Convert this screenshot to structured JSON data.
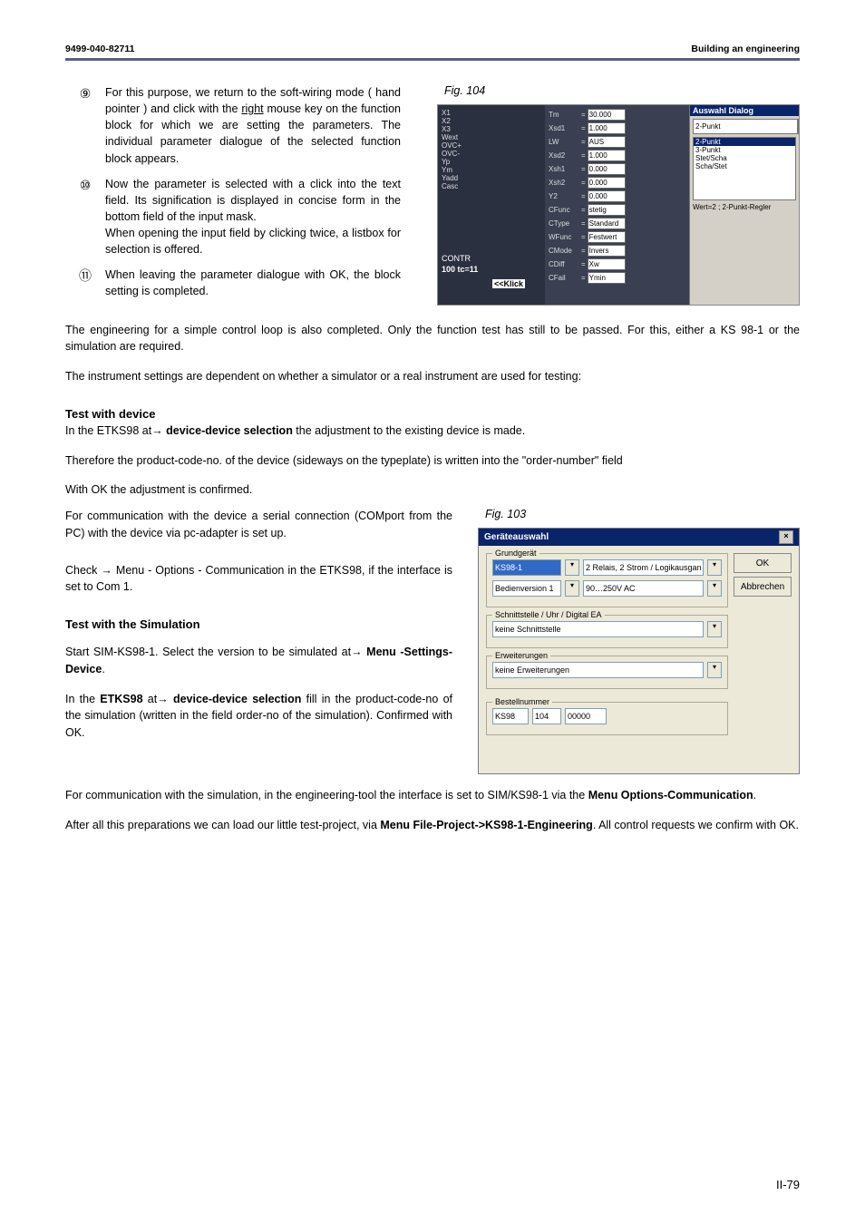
{
  "header": {
    "left": "9499-040-82711",
    "right": "Building an engineering"
  },
  "steps": [
    {
      "num": "⑨",
      "pre": "For this purpose, we return to the soft-wiring mode ( hand pointer ) and click with the ",
      "under": "right",
      "post": " mouse key on the function block for which we are setting the parameters.  The individual parameter dialogue of the selected function block appears."
    },
    {
      "num": "⑩",
      "text": "Now the parameter is selected with a click into the text field. Its signification is displayed in concise form in the bottom field of the input mask.\nWhen opening the input field by clicking twice, a listbox for selection is offered."
    },
    {
      "num": "⑪",
      "text": "When leaving the parameter dialogue with OK, the block setting is completed."
    }
  ],
  "fig104": {
    "caption": "Fig. 104",
    "rows": [
      [
        "Tm",
        "30.000"
      ],
      [
        "Xsd1",
        "1.000"
      ],
      [
        "LW",
        "AUS"
      ],
      [
        "Xsd2",
        "1.000"
      ],
      [
        "Xsh1",
        "0.000"
      ],
      [
        "Xsh2",
        "0.000"
      ],
      [
        "Y2",
        "0.000"
      ]
    ],
    "rows2": [
      [
        "CFunc",
        "stetig"
      ],
      [
        "CType",
        "Standard"
      ],
      [
        "WFunc",
        "Festwert"
      ],
      [
        "CMode",
        "Invers"
      ],
      [
        "CDiff",
        "Xw"
      ],
      [
        "CFail",
        "Ymin"
      ]
    ],
    "left_labels": [
      "X1",
      "X2",
      "X3",
      "Wext",
      "OVC+",
      "OVC-",
      "Yp",
      "Ym",
      "Yadd",
      "Casc"
    ],
    "bottom_left": [
      "CONTR",
      "100 tc=11"
    ],
    "dialog_title": "Auswahl Dialog",
    "dropdown_value": "2-Punkt",
    "list": [
      "2-Punkt",
      "3-Punkt",
      "Stet/Scha",
      "Scha/Stet"
    ],
    "status": "Wert=2 ; 2-Punkt-Regler",
    "klick": "<<Klick"
  },
  "body1": "The engineering for a simple control loop is also completed. Only the function test has still to be passed. For this, either a  KS 98-1 or the simulation are required.",
  "body2": "The instrument settings are dependent on whether a simulator or a real instrument are used for testing:",
  "t1": {
    "heading": "Test with device",
    "l1a": "In the ETKS98 at→ ",
    "l1b": "device-device selection",
    "l1c": "  the adjustment to the existing device is made.",
    "l2": "Therefore the product-code-no. of the device (sideways on the typeplate) is written into the \"order-number\" field",
    "l3": "With OK the adjustment is confirmed.",
    "l4": "For communication with the device a serial connection (COMport from the PC) with the device via pc-adapter is set up.",
    "l5": "Check → Menu - Options - Communication in the ETKS98, if the interface is set to Com 1."
  },
  "fig103": {
    "caption": "Fig. 103",
    "title": "Geräteauswahl",
    "g1": {
      "legend": "Grundgerät",
      "sel1a": "KS98-1",
      "sel1b": "2 Relais, 2 Strom / Logikausgang",
      "sel2a": "Bedienversion 1",
      "sel2b": "90…250V AC"
    },
    "g2": {
      "legend": "Schnittstelle / Uhr / Digital EA",
      "val": "keine Schnittstelle"
    },
    "g3": {
      "legend": "Erweiterungen",
      "val": "keine Erweiterungen"
    },
    "g4": {
      "legend": "Bestellnummer",
      "a": "KS98",
      "b": "104",
      "c": "00000"
    },
    "ok": "OK",
    "cancel": "Abbrechen"
  },
  "t2": {
    "heading": "Test with the Simulation",
    "l1a": "Start  SIM-KS98-1. Select the version to be simulated at→ ",
    "l1b": "Menu -Settings-Device",
    "l1c": ".",
    "l2a": "In the  ",
    "l2b": "ETKS98",
    "l2c": " at→ ",
    "l2d": "device-device selection",
    "l2e": " fill in the product-code-no of the simulation (written in the field order-no of the simulation). Confirmed with OK.",
    "l3a": "For communication with the simulation, in the engineering-tool the interface is set to SIM/KS98-1 via the  ",
    "l3b": "Menu Options-Communication",
    "l3c": ".",
    "l4a": "After all this preparations we can load our little test-project, via  ",
    "l4b": "Menu File-Project->KS98-1-Engineering",
    "l4c": ". All control requests we confirm with OK."
  },
  "pagenum": "II-79"
}
